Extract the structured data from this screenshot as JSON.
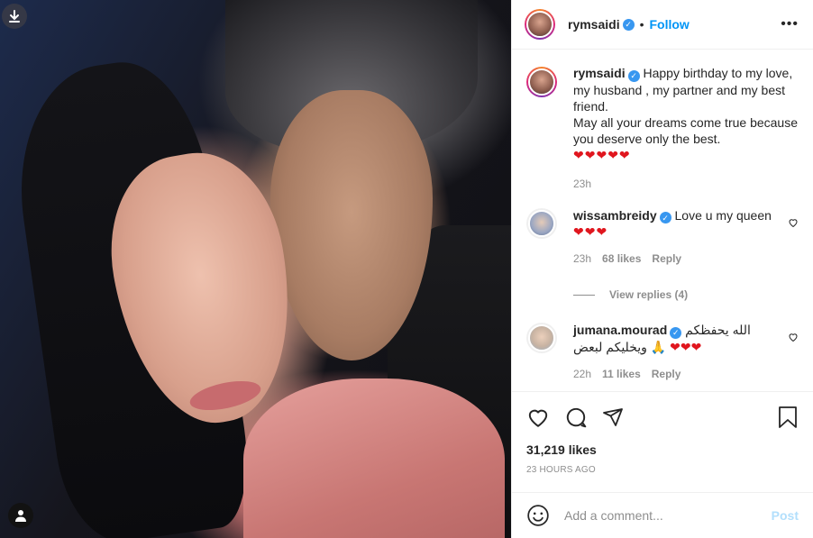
{
  "post": {
    "author": "rymsaidi",
    "follow_label": "Follow",
    "more_label": "•••",
    "dot": "•"
  },
  "caption": {
    "username": "rymsaidi",
    "text_lines": [
      "Happy birthday to my love,",
      "my husband , my partner and my best",
      "friend.",
      "May all your dreams come true because",
      "you deserve only the best."
    ],
    "hearts": "❤❤❤❤❤",
    "time": "23h"
  },
  "comments": [
    {
      "username": "wissambreidy",
      "text": "Love u my queen",
      "hearts": "❤❤❤",
      "time": "23h",
      "likes": "68 likes",
      "reply": "Reply",
      "view_replies": "View replies (4)"
    },
    {
      "username": "jumana.mourad",
      "text_line1": "الله يحفظكم",
      "text_line2_hearts": "❤❤❤",
      "text_line2_emoji": "🙏",
      "text_line2": "ويخليكم لبعض",
      "time": "22h",
      "likes": "11 likes",
      "reply": "Reply"
    }
  ],
  "stats": {
    "likes": "31,219 likes",
    "time_ago": "23 HOURS AGO"
  },
  "composer": {
    "placeholder": "Add a comment...",
    "post_label": "Post"
  },
  "colors": {
    "accent": "#0095f6",
    "verified": "#3897f0",
    "heart": "#e0161e",
    "muted": "#8e8e8e",
    "post_disabled": "#b2dffc"
  },
  "icons": {
    "download": "download-icon",
    "user": "user-icon",
    "heart": "heart-icon",
    "comment": "comment-icon",
    "share": "share-icon",
    "save": "bookmark-icon",
    "emoji": "emoji-icon",
    "verified": "verified-badge-icon"
  }
}
